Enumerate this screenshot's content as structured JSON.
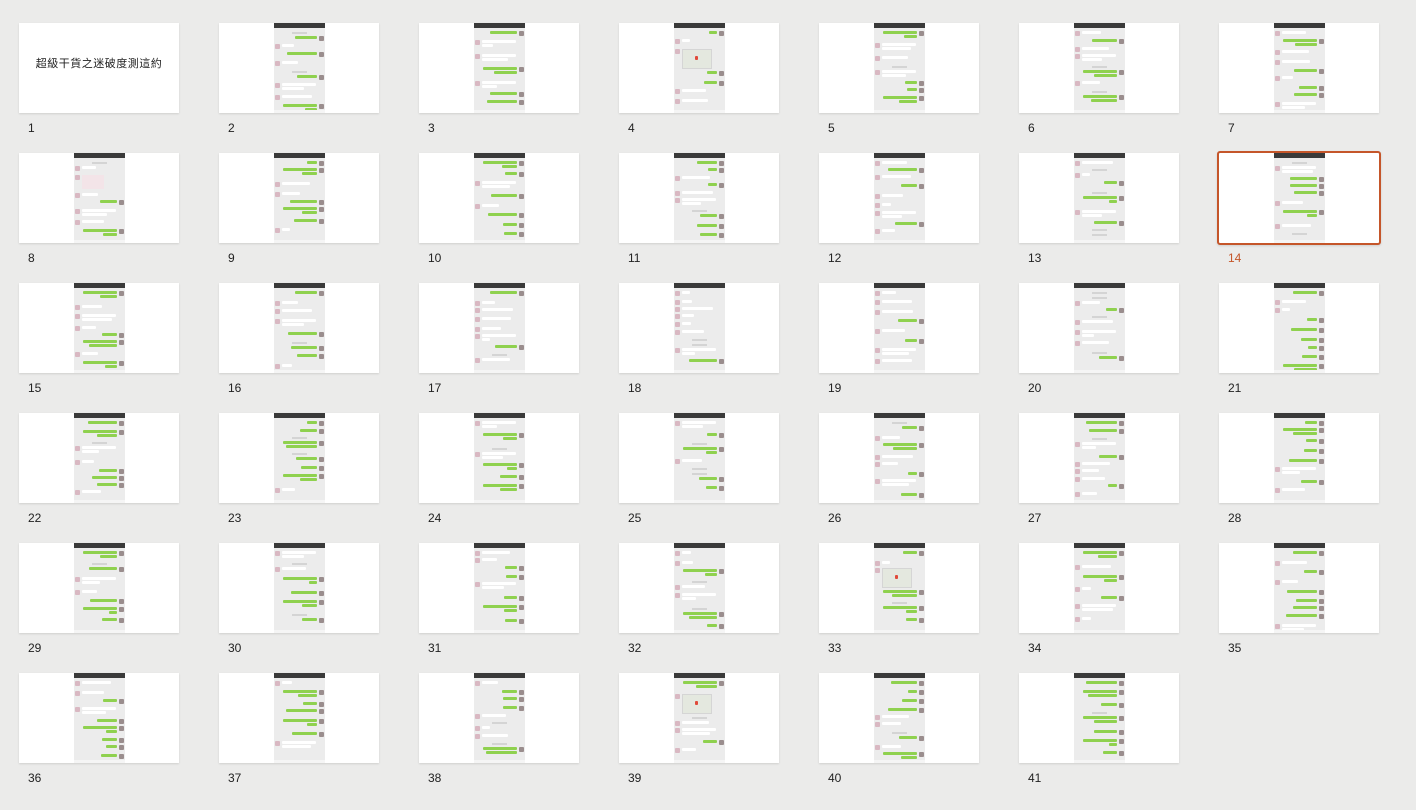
{
  "slides": [
    {
      "number": "1",
      "title": "超級干貨之迷破度測這約"
    },
    {
      "number": "2"
    },
    {
      "number": "3"
    },
    {
      "number": "4"
    },
    {
      "number": "5"
    },
    {
      "number": "6"
    },
    {
      "number": "7"
    },
    {
      "number": "8"
    },
    {
      "number": "9"
    },
    {
      "number": "10"
    },
    {
      "number": "11"
    },
    {
      "number": "12"
    },
    {
      "number": "13"
    },
    {
      "number": "14"
    },
    {
      "number": "15"
    },
    {
      "number": "16"
    },
    {
      "number": "17"
    },
    {
      "number": "18"
    },
    {
      "number": "19"
    },
    {
      "number": "20"
    },
    {
      "number": "21"
    },
    {
      "number": "22"
    },
    {
      "number": "23"
    },
    {
      "number": "24"
    },
    {
      "number": "25"
    },
    {
      "number": "26"
    },
    {
      "number": "27"
    },
    {
      "number": "28"
    },
    {
      "number": "29"
    },
    {
      "number": "30"
    },
    {
      "number": "31"
    },
    {
      "number": "32"
    },
    {
      "number": "33"
    },
    {
      "number": "34"
    },
    {
      "number": "35"
    },
    {
      "number": "36"
    },
    {
      "number": "37"
    },
    {
      "number": "38"
    },
    {
      "number": "39"
    },
    {
      "number": "40"
    },
    {
      "number": "41"
    }
  ],
  "selected_slide": "14",
  "colors": {
    "selection": "#c5562a",
    "background": "#ebebea",
    "chat_green": "#8fd14f"
  }
}
